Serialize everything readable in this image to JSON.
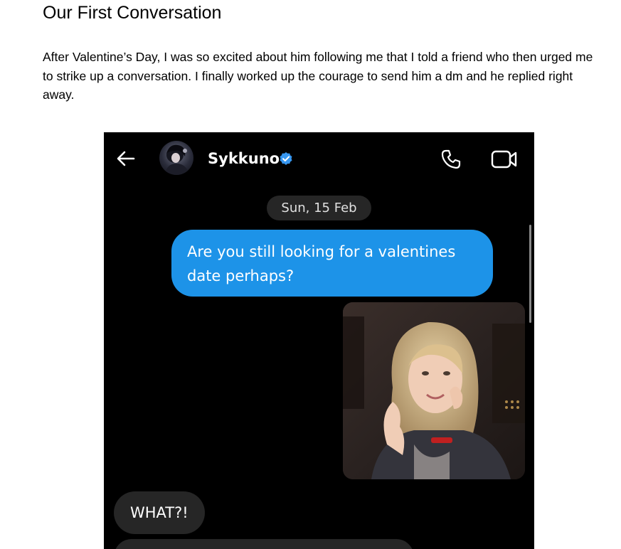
{
  "article": {
    "title": "Our First Conversation",
    "intro": "After Valentine’s Day, I was so excited about him following me that I told a friend who then urged me to strike up a conversation. I finally worked up the courage to send him a dm and he replied right away."
  },
  "chat": {
    "header": {
      "back_icon": "arrow-left-icon",
      "contact_name": "Sykkuno",
      "verified_icon": "verified-badge-icon",
      "call_icon": "phone-icon",
      "video_icon": "video-camera-icon"
    },
    "date_divider": "Sun, 15 Feb",
    "messages": [
      {
        "direction": "sent",
        "type": "text",
        "text": "Are you still looking for a valentines date perhaps?"
      },
      {
        "direction": "sent",
        "type": "gif"
      },
      {
        "direction": "received",
        "type": "text",
        "text": "WHAT?!"
      },
      {
        "direction": "received",
        "type": "text",
        "text": ""
      }
    ]
  },
  "colors": {
    "sent_bubble": "#1d93e8",
    "received_bubble": "#262626",
    "chat_background": "#000000",
    "verified_badge": "#3797f0"
  }
}
